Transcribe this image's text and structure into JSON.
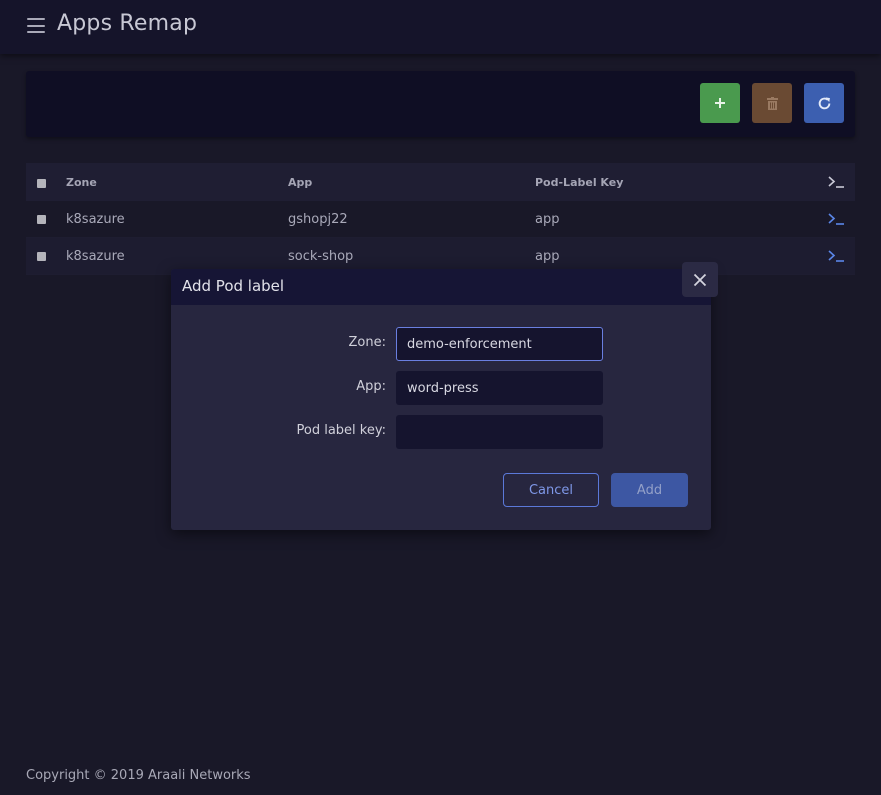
{
  "header": {
    "title": "Apps Remap"
  },
  "toolbar": {
    "add_icon": "plus-icon",
    "delete_icon": "trash-icon",
    "refresh_icon": "refresh-icon",
    "colors": {
      "add": "#4a9a4e",
      "delete": "#6a4a33",
      "refresh": "#3c5fb0"
    }
  },
  "table": {
    "columns": [
      "Zone",
      "App",
      "Pod-Label Key"
    ],
    "rows": [
      {
        "zone": "k8sazure",
        "app": "gshopj22",
        "key": "app"
      },
      {
        "zone": "k8sazure",
        "app": "sock-shop",
        "key": "app"
      }
    ]
  },
  "modal": {
    "title": "Add Pod label",
    "zone_label": "Zone:",
    "zone_value": "demo-enforcement",
    "app_label": "App:",
    "app_value": "word-press",
    "key_label": "Pod label key:",
    "key_value": "",
    "cancel_label": "Cancel",
    "add_label": "Add"
  },
  "footer": {
    "text": "Copyright © 2019 Araali Networks"
  }
}
